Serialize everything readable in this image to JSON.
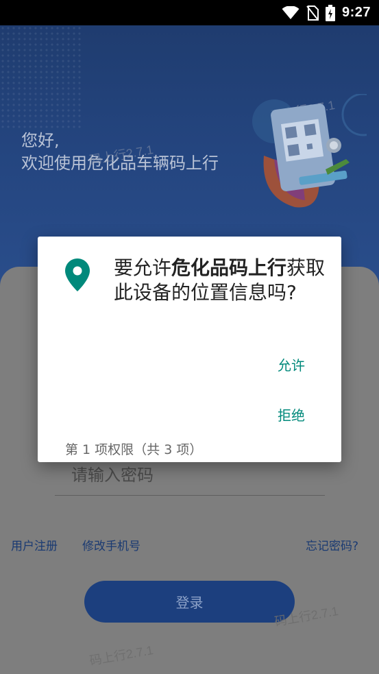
{
  "status_bar": {
    "time": "9:27"
  },
  "hero": {
    "greeting_line1": "您好,",
    "greeting_line2": "欢迎使用危化品车辆码上行",
    "watermark": "码上行2.7.1"
  },
  "form": {
    "password_placeholder": "请输入密码",
    "register_link": "用户注册",
    "change_phone_link": "修改手机号",
    "forgot_link": "忘记密码?",
    "login_button": "登录",
    "watermark": "码上行2.7.1"
  },
  "permission_dialog": {
    "title_prefix": "要允许",
    "app_name": "危化品码上行",
    "title_suffix": "获取此设备的位置信息吗?",
    "allow_button": "允许",
    "deny_button": "拒绝",
    "footer": "第 1 项权限（共 3 项）",
    "accent_color": "#00897b",
    "icon": "location-pin-icon"
  }
}
